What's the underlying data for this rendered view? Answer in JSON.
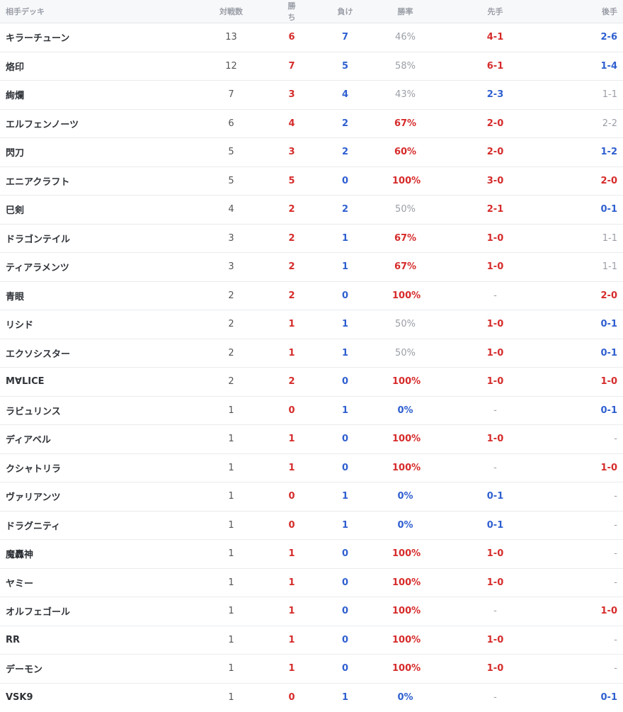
{
  "header": {
    "deck": "相手デッキ",
    "matches": "対戦数",
    "wins": "勝ち",
    "losses": "負け",
    "rate": "勝率",
    "first": "先手",
    "second": "後手"
  },
  "colors": {
    "red": "#d62b2b",
    "blue": "#2f5fd0",
    "gray": "#9a9ea6",
    "dark": "#555555"
  },
  "rows": [
    {
      "deck": "キラーチューン",
      "matches": "13",
      "wins": "6",
      "losses": "7",
      "rate": "46%",
      "first": "4-1",
      "second": "2-6",
      "rate_tone": "gray",
      "first_tone": "red",
      "second_tone": "blue"
    },
    {
      "deck": "烙印",
      "matches": "12",
      "wins": "7",
      "losses": "5",
      "rate": "58%",
      "first": "6-1",
      "second": "1-4",
      "rate_tone": "gray",
      "first_tone": "red",
      "second_tone": "blue"
    },
    {
      "deck": "絢爛",
      "matches": "7",
      "wins": "3",
      "losses": "4",
      "rate": "43%",
      "first": "2-3",
      "second": "1-1",
      "rate_tone": "gray",
      "first_tone": "blue",
      "second_tone": "gray"
    },
    {
      "deck": "エルフェンノーツ",
      "matches": "6",
      "wins": "4",
      "losses": "2",
      "rate": "67%",
      "first": "2-0",
      "second": "2-2",
      "rate_tone": "red",
      "first_tone": "red",
      "second_tone": "gray"
    },
    {
      "deck": "閃刀",
      "matches": "5",
      "wins": "3",
      "losses": "2",
      "rate": "60%",
      "first": "2-0",
      "second": "1-2",
      "rate_tone": "red",
      "first_tone": "red",
      "second_tone": "blue"
    },
    {
      "deck": "エニアクラフト",
      "matches": "5",
      "wins": "5",
      "losses": "0",
      "rate": "100%",
      "first": "3-0",
      "second": "2-0",
      "rate_tone": "red",
      "first_tone": "red",
      "second_tone": "red"
    },
    {
      "deck": "巳剣",
      "matches": "4",
      "wins": "2",
      "losses": "2",
      "rate": "50%",
      "first": "2-1",
      "second": "0-1",
      "rate_tone": "gray",
      "first_tone": "red",
      "second_tone": "blue"
    },
    {
      "deck": "ドラゴンテイル",
      "matches": "3",
      "wins": "2",
      "losses": "1",
      "rate": "67%",
      "first": "1-0",
      "second": "1-1",
      "rate_tone": "red",
      "first_tone": "red",
      "second_tone": "gray"
    },
    {
      "deck": "ティアラメンツ",
      "matches": "3",
      "wins": "2",
      "losses": "1",
      "rate": "67%",
      "first": "1-0",
      "second": "1-1",
      "rate_tone": "red",
      "first_tone": "red",
      "second_tone": "gray"
    },
    {
      "deck": "青眼",
      "matches": "2",
      "wins": "2",
      "losses": "0",
      "rate": "100%",
      "first": "-",
      "second": "2-0",
      "rate_tone": "red",
      "first_tone": "gray",
      "second_tone": "red"
    },
    {
      "deck": "リシド",
      "matches": "2",
      "wins": "1",
      "losses": "1",
      "rate": "50%",
      "first": "1-0",
      "second": "0-1",
      "rate_tone": "gray",
      "first_tone": "red",
      "second_tone": "blue"
    },
    {
      "deck": "エクソシスター",
      "matches": "2",
      "wins": "1",
      "losses": "1",
      "rate": "50%",
      "first": "1-0",
      "second": "0-1",
      "rate_tone": "gray",
      "first_tone": "red",
      "second_tone": "blue"
    },
    {
      "deck": "M∀LICE",
      "matches": "2",
      "wins": "2",
      "losses": "0",
      "rate": "100%",
      "first": "1-0",
      "second": "1-0",
      "rate_tone": "red",
      "first_tone": "red",
      "second_tone": "red"
    },
    {
      "deck": "ラビュリンス",
      "matches": "1",
      "wins": "0",
      "losses": "1",
      "rate": "0%",
      "first": "-",
      "second": "0-1",
      "rate_tone": "blue",
      "first_tone": "gray",
      "second_tone": "blue"
    },
    {
      "deck": "ディアベル",
      "matches": "1",
      "wins": "1",
      "losses": "0",
      "rate": "100%",
      "first": "1-0",
      "second": "-",
      "rate_tone": "red",
      "first_tone": "red",
      "second_tone": "gray"
    },
    {
      "deck": "クシャトリラ",
      "matches": "1",
      "wins": "1",
      "losses": "0",
      "rate": "100%",
      "first": "-",
      "second": "1-0",
      "rate_tone": "red",
      "first_tone": "gray",
      "second_tone": "red"
    },
    {
      "deck": "ヴァリアンツ",
      "matches": "1",
      "wins": "0",
      "losses": "1",
      "rate": "0%",
      "first": "0-1",
      "second": "-",
      "rate_tone": "blue",
      "first_tone": "blue",
      "second_tone": "gray"
    },
    {
      "deck": "ドラグニティ",
      "matches": "1",
      "wins": "0",
      "losses": "1",
      "rate": "0%",
      "first": "0-1",
      "second": "-",
      "rate_tone": "blue",
      "first_tone": "blue",
      "second_tone": "gray"
    },
    {
      "deck": "魔轟神",
      "matches": "1",
      "wins": "1",
      "losses": "0",
      "rate": "100%",
      "first": "1-0",
      "second": "-",
      "rate_tone": "red",
      "first_tone": "red",
      "second_tone": "gray"
    },
    {
      "deck": "ヤミー",
      "matches": "1",
      "wins": "1",
      "losses": "0",
      "rate": "100%",
      "first": "1-0",
      "second": "-",
      "rate_tone": "red",
      "first_tone": "red",
      "second_tone": "gray"
    },
    {
      "deck": "オルフェゴール",
      "matches": "1",
      "wins": "1",
      "losses": "0",
      "rate": "100%",
      "first": "-",
      "second": "1-0",
      "rate_tone": "red",
      "first_tone": "gray",
      "second_tone": "red"
    },
    {
      "deck": "RR",
      "matches": "1",
      "wins": "1",
      "losses": "0",
      "rate": "100%",
      "first": "1-0",
      "second": "-",
      "rate_tone": "red",
      "first_tone": "red",
      "second_tone": "gray"
    },
    {
      "deck": "デーモン",
      "matches": "1",
      "wins": "1",
      "losses": "0",
      "rate": "100%",
      "first": "1-0",
      "second": "-",
      "rate_tone": "red",
      "first_tone": "red",
      "second_tone": "gray"
    },
    {
      "deck": "VSK9",
      "matches": "1",
      "wins": "0",
      "losses": "1",
      "rate": "0%",
      "first": "-",
      "second": "0-1",
      "rate_tone": "blue",
      "first_tone": "gray",
      "second_tone": "blue"
    }
  ]
}
